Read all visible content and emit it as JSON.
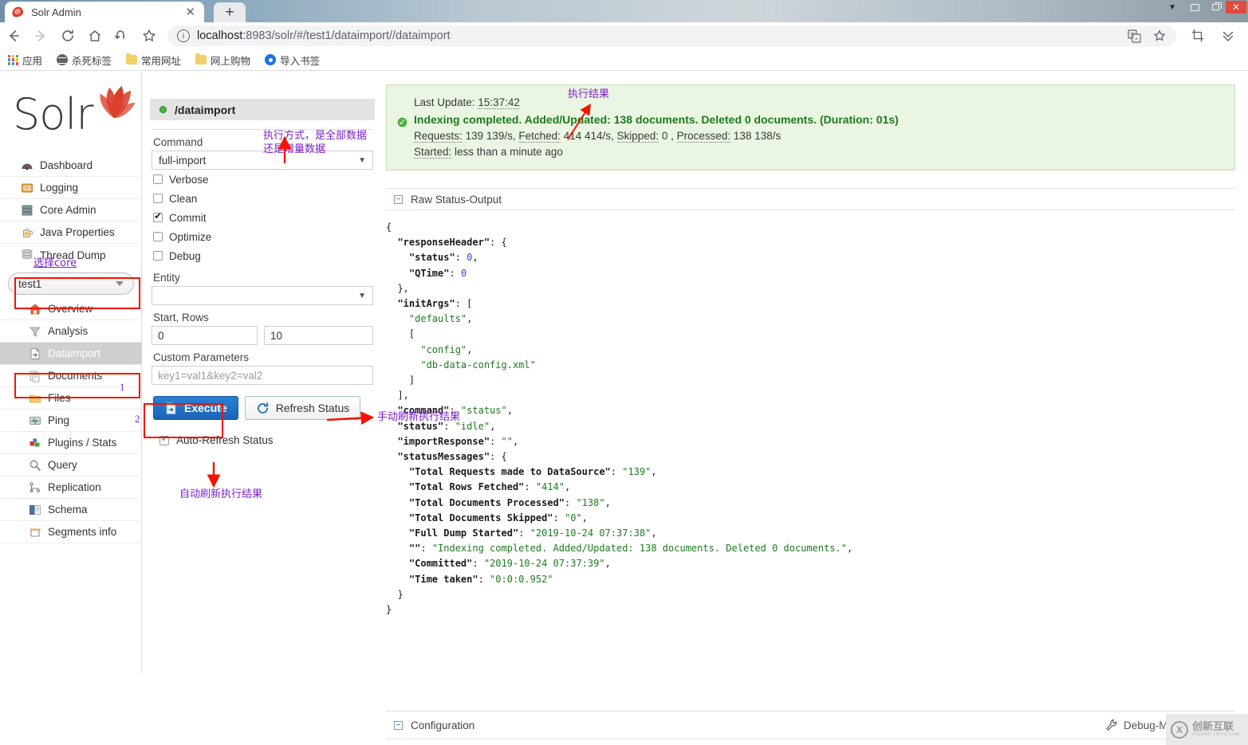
{
  "browser": {
    "tab": {
      "title": "Solr Admin",
      "favicon": "solr-favicon",
      "close": "✕"
    },
    "newtab_label": "+",
    "nav": {
      "back": "back-arrow-icon",
      "forward": "forward-arrow-icon",
      "reload": "reload-icon",
      "home": "home-icon",
      "undo": "undo-arrow-icon",
      "star": "star-icon"
    },
    "omnibox": {
      "host": "localhost",
      "rest": ":8983/solr/#/test1/dataimport//dataimport",
      "full_url": "localhost:8983/solr/#/test1/dataimport//dataimport",
      "info_icon": "info-circle-icon",
      "translate_icon": "translate-icon",
      "bookmark_icon": "star-icon"
    },
    "toolbar_right": {
      "crop_icon": "crop-icon",
      "chevrons_icon": "double-chevron-down-icon"
    },
    "window_controls": {
      "minimize": "minimize-icon",
      "maximize": "maximize-icon",
      "close": "✕"
    },
    "bookmarks": [
      {
        "label": "应用",
        "icon": "apps-grid-icon"
      },
      {
        "label": "杀死标签",
        "icon": "globe-icon"
      },
      {
        "label": "常用网址",
        "icon": "folder-icon"
      },
      {
        "label": "网上购物",
        "icon": "folder-icon"
      },
      {
        "label": "导入书签",
        "icon": "gear-icon"
      }
    ]
  },
  "sidebar": {
    "logo_text": "Solr",
    "top_items": [
      {
        "label": "Dashboard",
        "icon": "speedometer-icon"
      },
      {
        "label": "Logging",
        "icon": "log-book-icon"
      },
      {
        "label": "Core Admin",
        "icon": "server-stack-icon"
      },
      {
        "label": "Java Properties",
        "icon": "java-cup-icon"
      },
      {
        "label": "Thread Dump",
        "icon": "stack-layers-icon"
      }
    ],
    "core_hint": "选择core",
    "core_selected": "test1",
    "core_items": [
      {
        "label": "Overview",
        "icon": "house-icon"
      },
      {
        "label": "Analysis",
        "icon": "funnel-icon"
      },
      {
        "label": "Dataimport",
        "icon": "dataimport-page-icon",
        "active": true
      },
      {
        "label": "Documents",
        "icon": "documents-icon"
      },
      {
        "label": "Files",
        "icon": "folder-icon"
      },
      {
        "label": "Ping",
        "icon": "pulse-monitor-icon"
      },
      {
        "label": "Plugins / Stats",
        "icon": "plugin-blocks-icon"
      },
      {
        "label": "Query",
        "icon": "magnifier-icon"
      },
      {
        "label": "Replication",
        "icon": "replication-nodes-icon"
      },
      {
        "label": "Schema",
        "icon": "book-icon"
      },
      {
        "label": "Segments info",
        "icon": "segments-icon"
      }
    ],
    "marker_1": "1",
    "marker_2": "2"
  },
  "dataimport": {
    "panel_title": "/dataimport",
    "status_dot_color": "#48b34a",
    "command_label": "Command",
    "command_value": "full-import",
    "checkboxes": [
      {
        "label": "Verbose",
        "checked": false
      },
      {
        "label": "Clean",
        "checked": false
      },
      {
        "label": "Commit",
        "checked": true
      },
      {
        "label": "Optimize",
        "checked": false
      },
      {
        "label": "Debug",
        "checked": false
      }
    ],
    "entity_label": "Entity",
    "entity_value": "",
    "start_rows_label": "Start, Rows",
    "start_value": "0",
    "rows_value": "10",
    "custom_params_label": "Custom Parameters",
    "custom_params_placeholder": "key1=val1&key2=val2",
    "execute_label": "Execute",
    "refresh_label": "Refresh Status",
    "auto_refresh_label": "Auto-Refresh Status",
    "auto_refresh_checked": true
  },
  "status": {
    "last_update_label": "Last Update:",
    "last_update_value": "15:37:42",
    "main_message": "Indexing completed. Added/Updated: 138 documents. Deleted 0 documents. (Duration: 01s)",
    "requests_label": "Requests:",
    "requests_value": "139 139/s,",
    "fetched_label": "Fetched:",
    "fetched_value": "414 414/s,",
    "skipped_label": "Skipped:",
    "skipped_value": "0 ,",
    "processed_label": "Processed:",
    "processed_value": "138 138/s",
    "started_label": "Started:",
    "started_value": "less than a minute ago",
    "check_icon": "check-circle-icon"
  },
  "raw_section": {
    "title": "Raw Status-Output",
    "toggle_icon": "collapse-minus-icon",
    "json_lines": [
      "{",
      "  \"responseHeader\": {",
      "    \"status\": 0,",
      "    \"QTime\": 0",
      "  },",
      "  \"initArgs\": [",
      "    \"defaults\",",
      "    [",
      "      \"config\",",
      "      \"db-data-config.xml\"",
      "    ]",
      "  ],",
      "  \"command\": \"status\",",
      "  \"status\": \"idle\",",
      "  \"importResponse\": \"\",",
      "  \"statusMessages\": {",
      "    \"Total Requests made to DataSource\": \"139\",",
      "    \"Total Rows Fetched\": \"414\",",
      "    \"Total Documents Processed\": \"138\",",
      "    \"Total Documents Skipped\": \"0\",",
      "    \"Full Dump Started\": \"2019-10-24 07:37:38\",",
      "    \"\": \"Indexing completed. Added/Updated: 138 documents. Deleted 0 documents.\",",
      "    \"Committed\": \"2019-10-24 07:37:39\",",
      "    \"Time taken\": \"0:0:0.952\"",
      "  }",
      "}"
    ]
  },
  "configuration": {
    "title": "Configuration",
    "toggle_icon": "collapse-minus-icon",
    "debug_mode_label": "Debug-Mode",
    "debug_mode_icon": "wrench-icon"
  },
  "annotations": {
    "exec_result": "执行结果",
    "command_note_line1": "执行方式，是全部数据",
    "command_note_line2": "还是增量数据",
    "manual_refresh": "手动刷新执行结果",
    "auto_refresh": "自动刷新执行结果",
    "box_color": "#f11500",
    "text_color": "#7a1fd1"
  },
  "watermark": {
    "mark": "X",
    "title": "创新互联",
    "subtitle": "CHUANG XIN HU LIAN"
  }
}
